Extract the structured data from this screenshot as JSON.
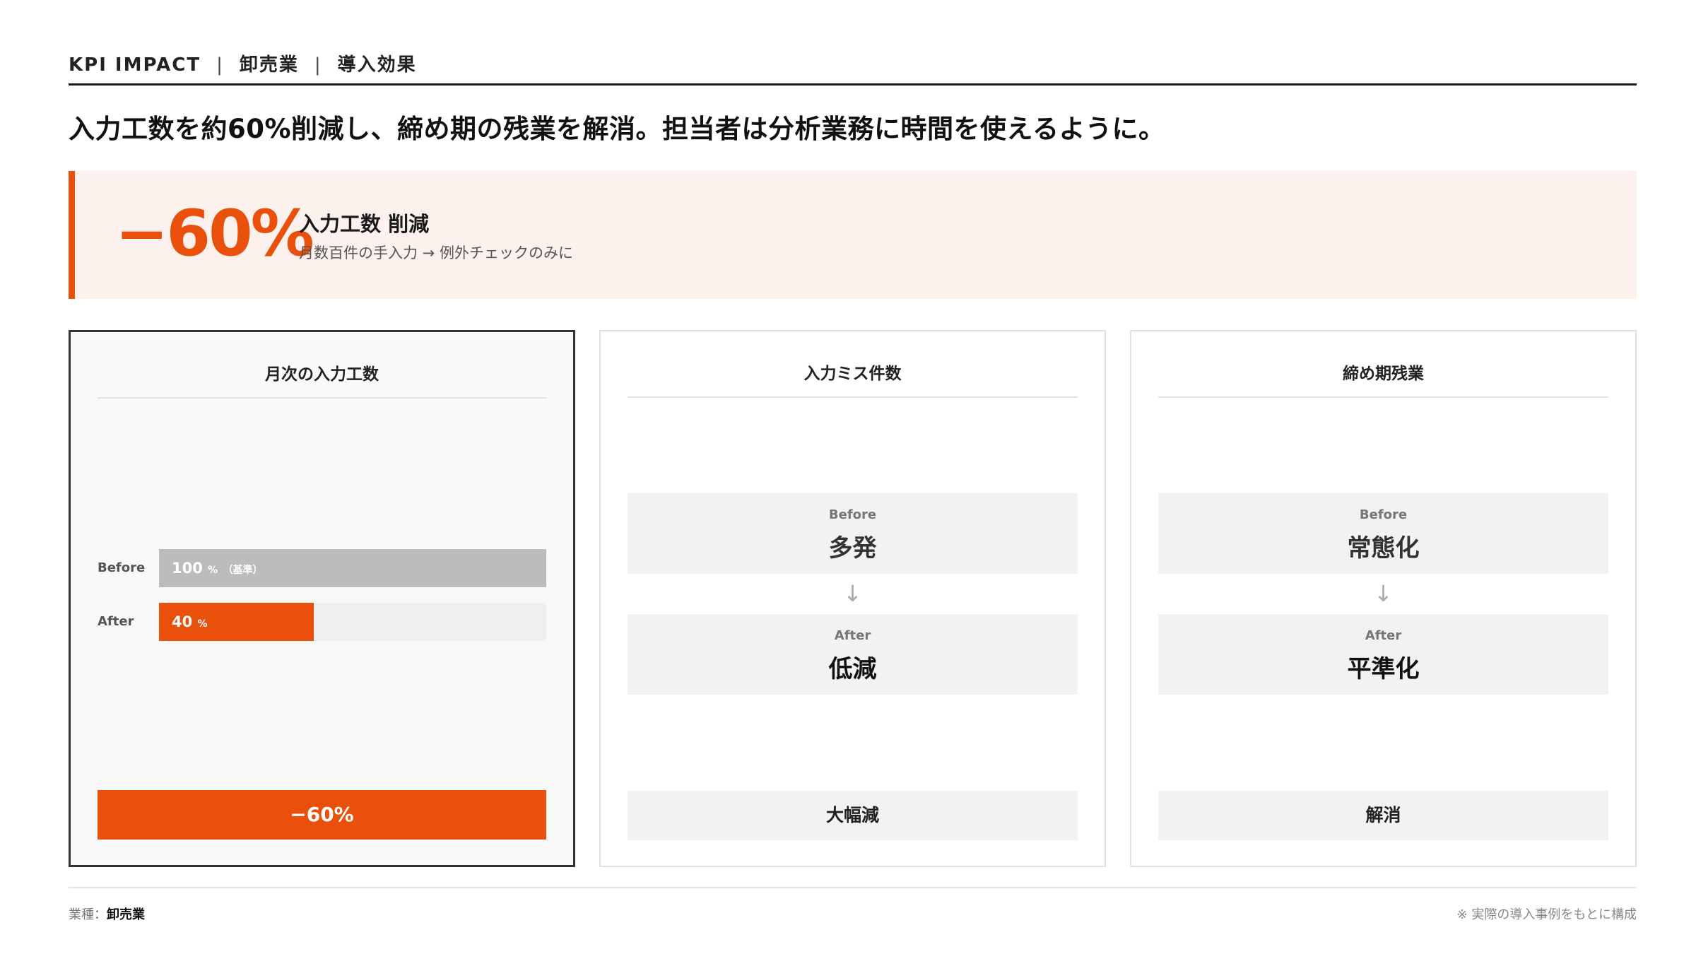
{
  "header": {
    "kpi": "KPI IMPACT",
    "separator": "|",
    "industry": "卸売業",
    "section": "導入効果"
  },
  "headline": "入力工数を約60%削減し、締め期の残業を解消。担当者は分析業務に時間を使えるように。",
  "banner": {
    "value": "−60%",
    "title": "入力工数 削減",
    "subtitle": "月数百件の手入力 → 例外チェックのみに"
  },
  "cards": [
    {
      "title": "月次の入力工数",
      "bars": [
        {
          "label": "Before",
          "value": 100,
          "value_text": "100",
          "unit": "%",
          "note": "（基準）"
        },
        {
          "label": "After",
          "value": 40,
          "value_text": "40",
          "unit": "%",
          "note": ""
        }
      ],
      "result": "−60%"
    },
    {
      "title": "入力ミス件数",
      "before_label": "Before",
      "before_value": "多発",
      "arrow": "↓",
      "after_label": "After",
      "after_value": "低減",
      "result": "大幅減"
    },
    {
      "title": "締め期残業",
      "before_label": "Before",
      "before_value": "常態化",
      "arrow": "↓",
      "after_label": "After",
      "after_value": "平準化",
      "result": "解消"
    }
  ],
  "footer": {
    "left_label": "業種：",
    "left_value": "卸売業",
    "right": "※ 実際の導入事例をもとに構成"
  },
  "colors": {
    "accent": "#e8500c",
    "banner_bg": "#fcf1ec",
    "bar_gray": "#bcbcbc",
    "box_gray": "#f2f2f2"
  }
}
